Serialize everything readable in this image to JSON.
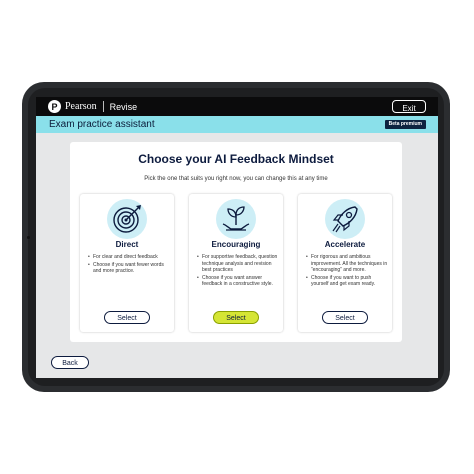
{
  "app": {
    "brand_logo_letter": "P",
    "brand_name": "Pearson",
    "product_name": "Revise"
  },
  "header": {
    "exit_label": "Exit",
    "title": "Exam practice assistant",
    "badge": "Beta premium"
  },
  "main": {
    "title": "Choose your AI Feedback Mindset",
    "subtitle": "Pick the one that suits you right now, you can change this at any time",
    "cards": [
      {
        "title": "Direct",
        "icon": "target-icon",
        "bullets": [
          "For clear and direct feedback",
          "Choose if you want fewer words and more practice."
        ],
        "button": "Select",
        "selected": false
      },
      {
        "title": "Encouraging",
        "icon": "seedling-hands-icon",
        "bullets": [
          "For supportive feedback, question technique analysis and revision best practices",
          "Choose if you want answer feedback in a constructive style."
        ],
        "button": "Select",
        "selected": true
      },
      {
        "title": "Accelerate",
        "icon": "rocket-icon",
        "bullets": [
          "For rigorous and ambitious improvement. All the techniques in “encouraging” and more.",
          "Choose if you want to push yourself and get exam ready."
        ],
        "button": "Select",
        "selected": false
      }
    ]
  },
  "footer": {
    "back_label": "Back"
  },
  "colors": {
    "accent_bar": "#8ae0ea",
    "navy": "#0d1b3e",
    "selected_button": "#d5e535",
    "icon_bg": "#cdeef6"
  }
}
